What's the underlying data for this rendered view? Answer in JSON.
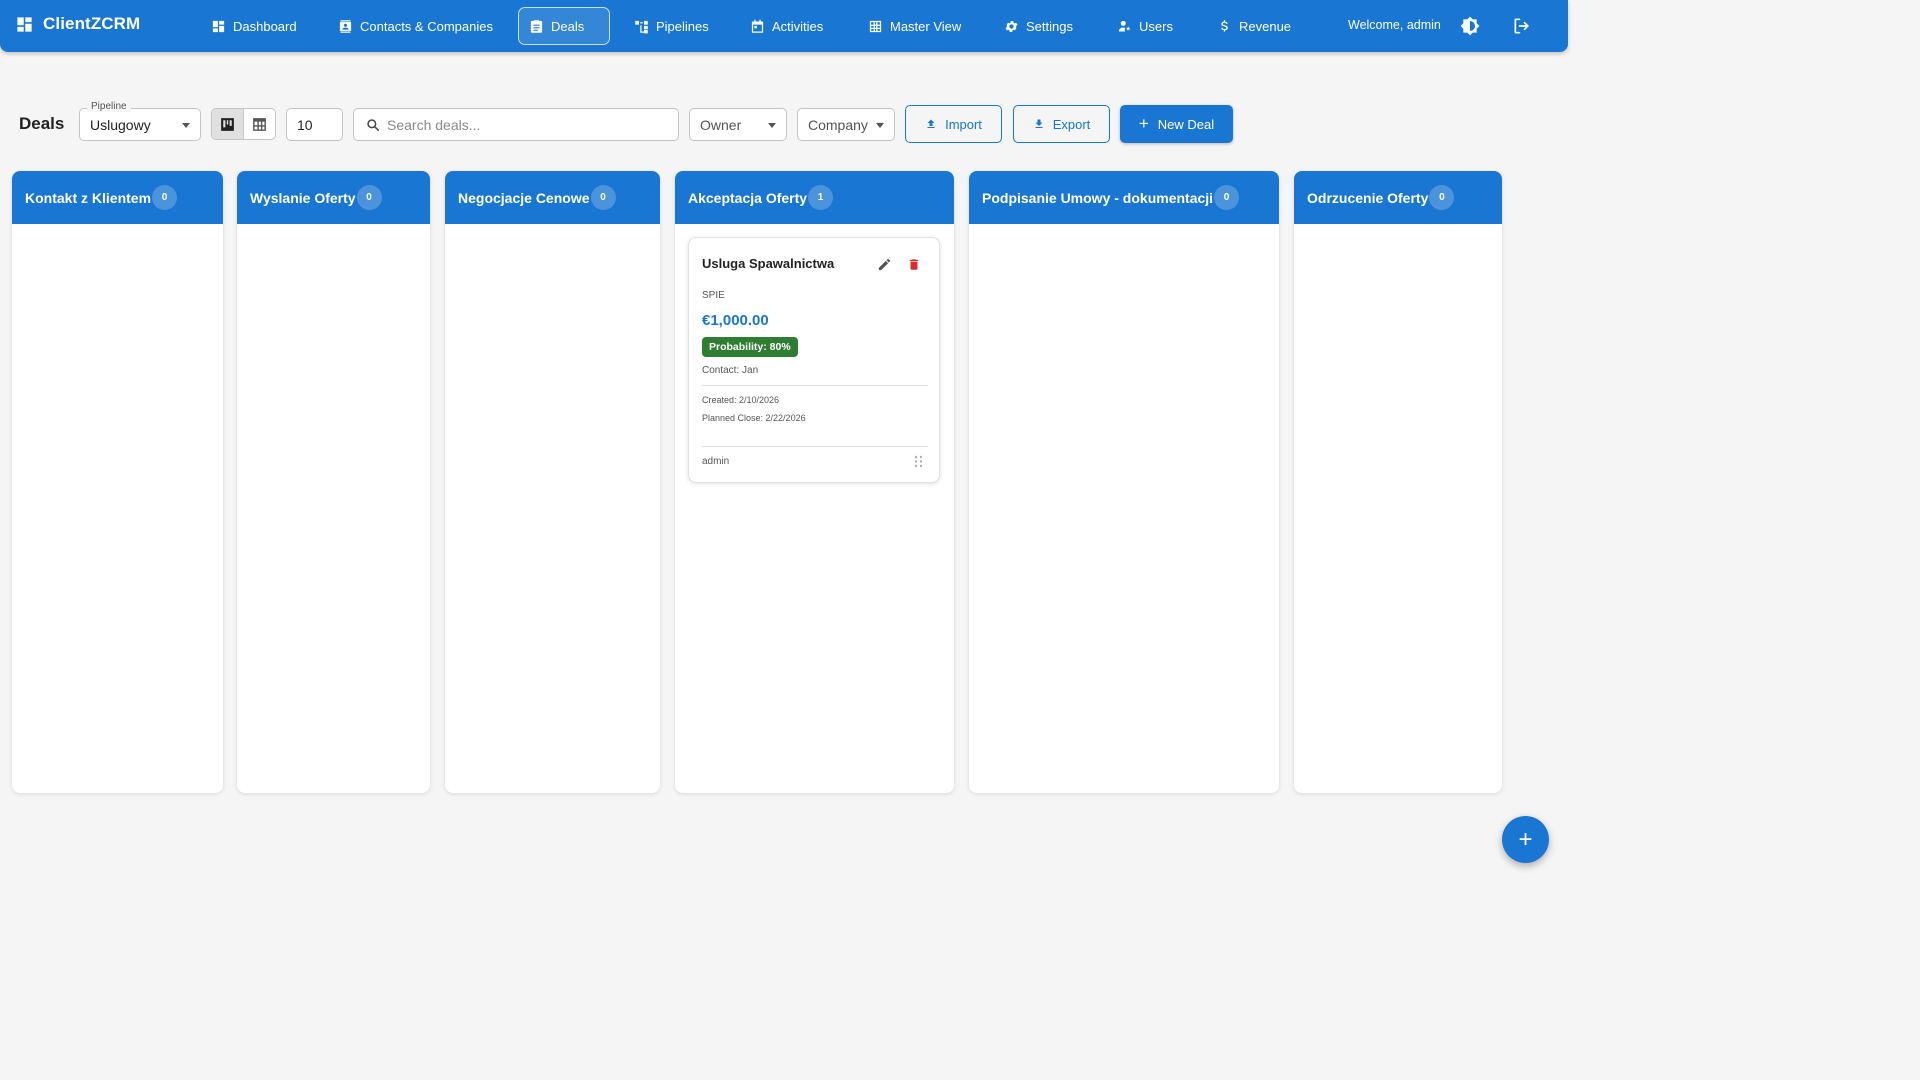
{
  "app": {
    "brand": "ClientZCRM",
    "welcome": "Welcome, admin"
  },
  "nav": [
    {
      "label": "Dashboard",
      "icon": "dashboard-icon"
    },
    {
      "label": "Contacts & Companies",
      "icon": "contacts-icon"
    },
    {
      "label": "Deals",
      "icon": "deals-icon",
      "active": true
    },
    {
      "label": "Pipelines",
      "icon": "pipelines-icon"
    },
    {
      "label": "Activities",
      "icon": "calendar-icon"
    },
    {
      "label": "Master View",
      "icon": "table-icon"
    },
    {
      "label": "Settings",
      "icon": "gear-icon"
    },
    {
      "label": "Users",
      "icon": "users-icon"
    },
    {
      "label": "Revenue",
      "icon": "dollar-icon"
    }
  ],
  "toolbar": {
    "title": "Deals",
    "pipeline_label": "Pipeline",
    "pipeline_value": "Uslugowy",
    "page_size": "10",
    "search_placeholder": "Search deals...",
    "owner_label": "Owner",
    "company_label": "Company",
    "import_label": "Import",
    "export_label": "Export",
    "new_deal_label": "New Deal"
  },
  "columns": [
    {
      "name": "Kontakt z Klientem",
      "count": "0"
    },
    {
      "name": "Wyslanie Oferty",
      "count": "0"
    },
    {
      "name": "Negocjacje Cenowe",
      "count": "0"
    },
    {
      "name": "Akceptacja Oferty",
      "count": "1"
    },
    {
      "name": "Podpisanie Umowy - dokumentacji",
      "count": "0"
    },
    {
      "name": "Odrzucenie Oferty",
      "count": "0"
    }
  ],
  "deal": {
    "title": "Usluga Spawalnictwa",
    "company": "SPIE",
    "value": "€1,000.00",
    "probability": "Probability: 80%",
    "contact": "Contact: Jan",
    "created": "Created: 2/10/2026",
    "planned_close": "Planned Close: 2/22/2026",
    "owner": "admin"
  },
  "colors": {
    "primary": "#1976d2",
    "success": "#2e7d32",
    "danger": "#d32f2f",
    "background": "#f5f5f5"
  }
}
